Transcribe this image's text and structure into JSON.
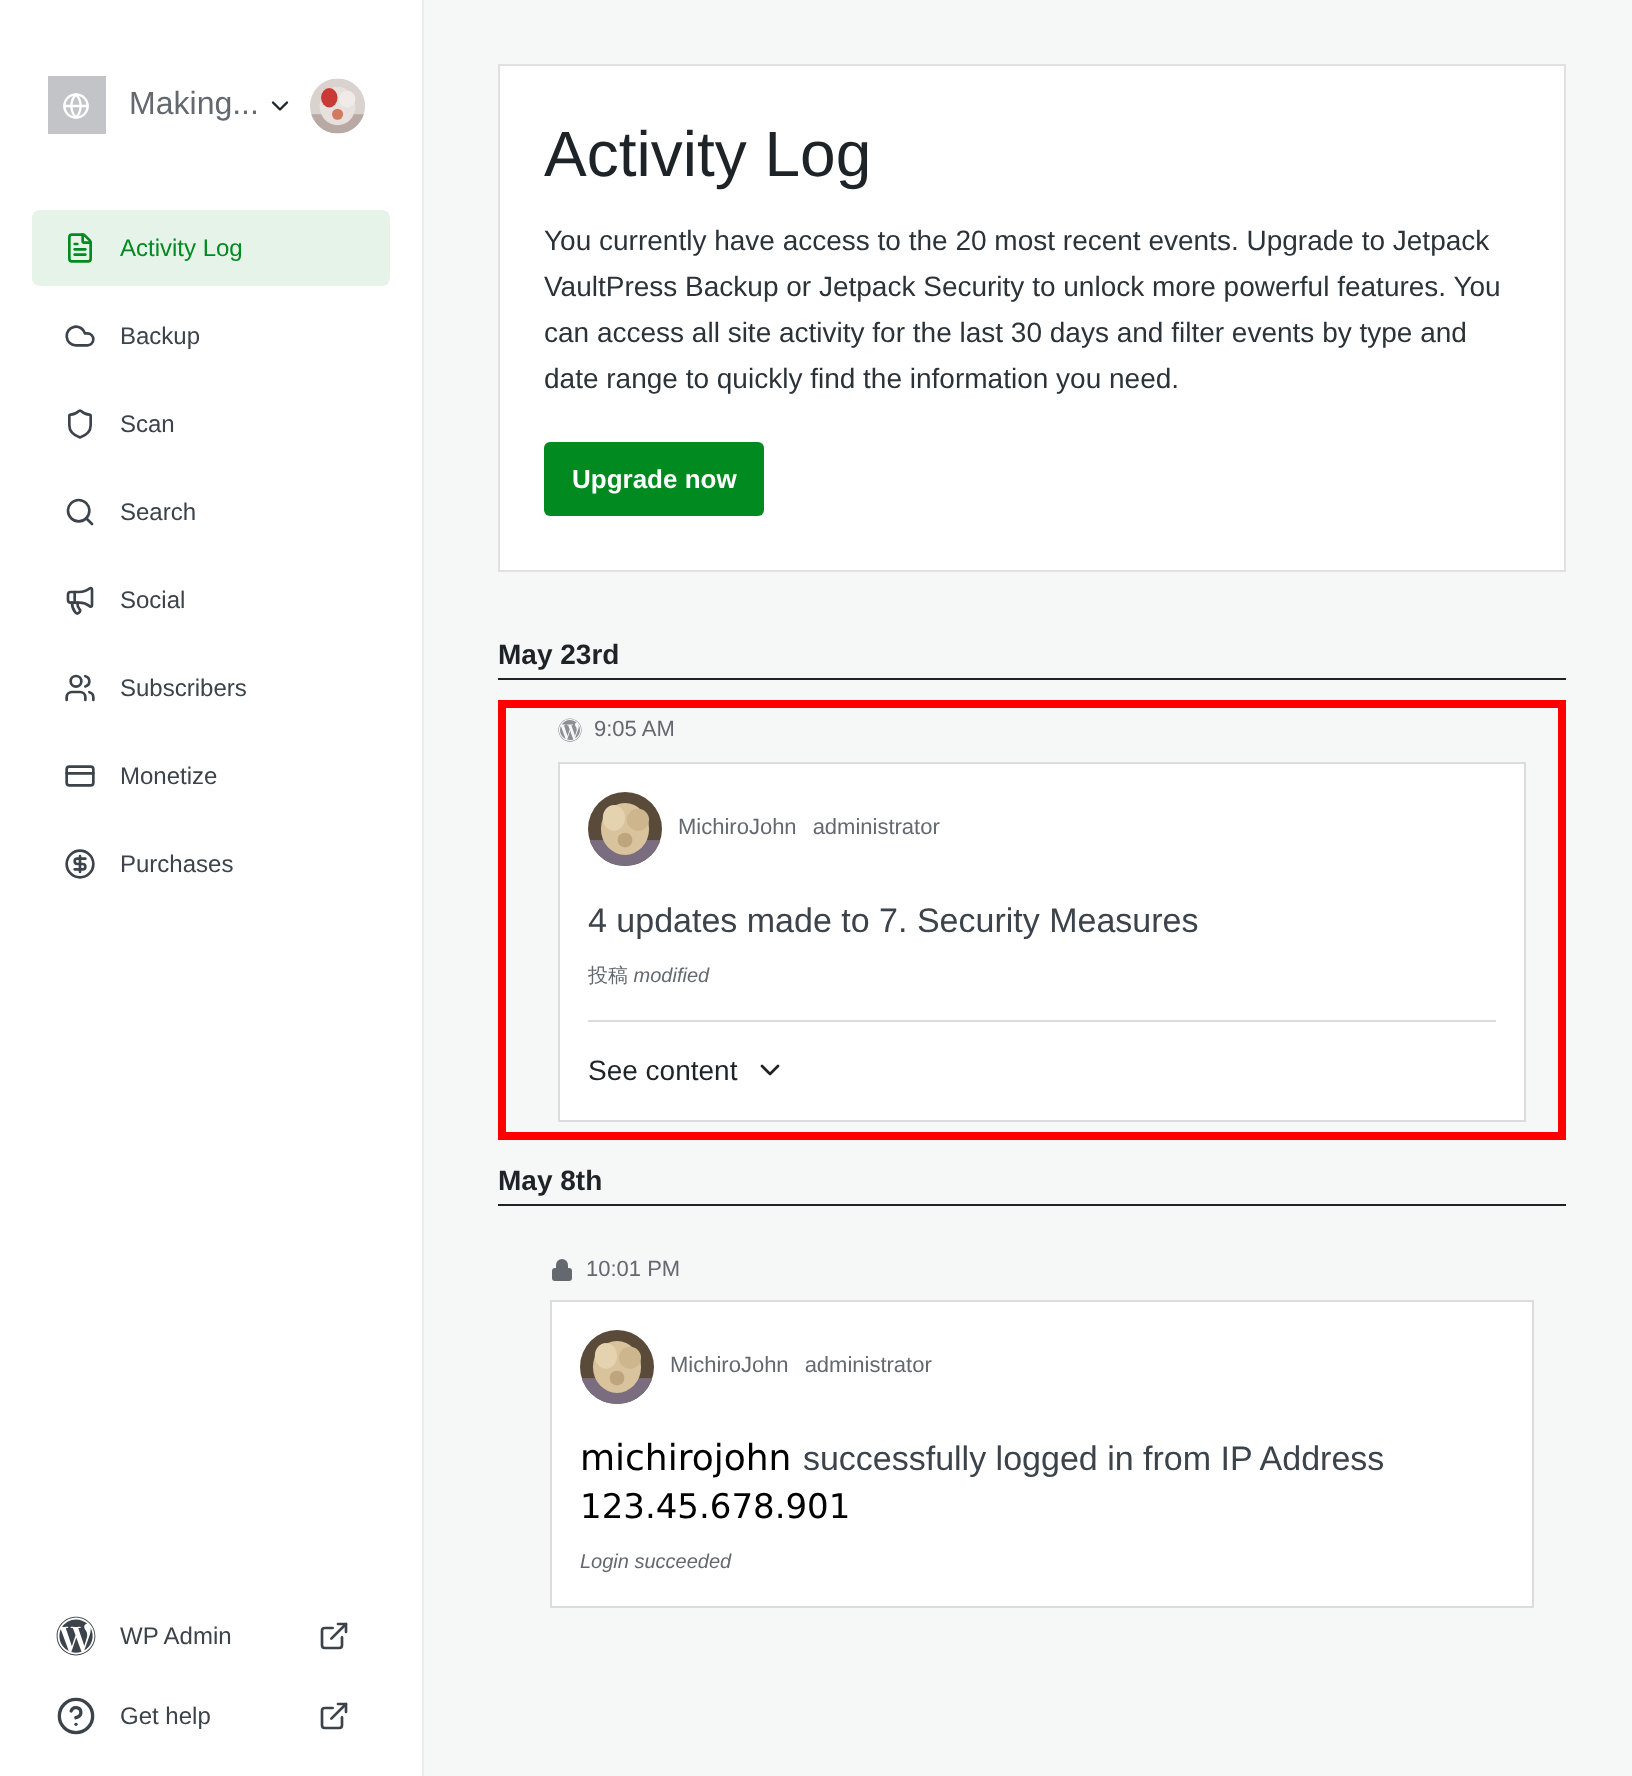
{
  "site": {
    "name": "Making..."
  },
  "nav": [
    {
      "label": "Activity Log",
      "kind": "log",
      "selected": true
    },
    {
      "label": "Backup",
      "kind": "cloud",
      "selected": false
    },
    {
      "label": "Scan",
      "kind": "shield",
      "selected": false
    },
    {
      "label": "Search",
      "kind": "search",
      "selected": false
    },
    {
      "label": "Social",
      "kind": "megaphone",
      "selected": false
    },
    {
      "label": "Subscribers",
      "kind": "people",
      "selected": false
    },
    {
      "label": "Monetize",
      "kind": "card",
      "selected": false
    },
    {
      "label": "Purchases",
      "kind": "dollar",
      "selected": false
    }
  ],
  "footer_links": [
    {
      "label": "WP Admin",
      "kind": "wordpress"
    },
    {
      "label": "Get help",
      "kind": "help"
    }
  ],
  "intro": {
    "title": "Activity Log",
    "text": "You currently have access to the 20 most recent events. Upgrade to Jetpack VaultPress Backup or Jetpack Security to unlock more powerful features. You can access all site activity for the last 30 days and filter events by type and date range to quickly find the information you need.",
    "button": "Upgrade now"
  },
  "days": [
    {
      "date": "May 23rd",
      "events": [
        {
          "kind": "wordpress",
          "time": "9:05 AM",
          "highlighted": true,
          "user": "MichiroJohn",
          "role": "administrator",
          "title": "4 updates made to 7. Security Measures",
          "subtitle_prefix": "投稿",
          "subtitle": "modified",
          "toggle": "See content"
        }
      ]
    },
    {
      "date": "May 8th",
      "events": [
        {
          "kind": "lock",
          "time": "10:01 PM",
          "highlighted": false,
          "user": "MichiroJohn",
          "role": "administrator",
          "actor": "michirojohn",
          "title": "successfully logged in from IP Address",
          "ip": "123.45.678.901",
          "subtitle": "Login succeeded"
        }
      ]
    }
  ]
}
